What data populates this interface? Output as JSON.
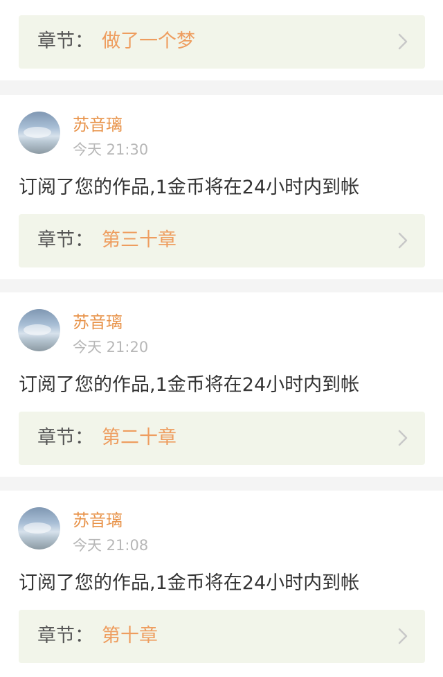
{
  "partial_entry": {
    "chapter_label": "章节：",
    "chapter_title": "做了一个梦"
  },
  "entries": [
    {
      "username": "苏音璃",
      "time": "今天 21:30",
      "message": "订阅了您的作品,1金币将在24小时内到帐",
      "chapter_label": "章节：",
      "chapter_title": "第三十章"
    },
    {
      "username": "苏音璃",
      "time": "今天 21:20",
      "message": "订阅了您的作品,1金币将在24小时内到帐",
      "chapter_label": "章节：",
      "chapter_title": "第二十章"
    },
    {
      "username": "苏音璃",
      "time": "今天 21:08",
      "message": "订阅了您的作品,1金币将在24小时内到帐",
      "chapter_label": "章节：",
      "chapter_title": "第十章"
    }
  ],
  "icons": {
    "chevron": "chevron-right-icon",
    "avatar": "avatar-image"
  },
  "colors": {
    "username": "#e8934a",
    "chapter_title": "#ee9d5f",
    "chapter_bg": "#f2f5ea",
    "time": "#b7b7b7",
    "accent": "#e0609a"
  }
}
